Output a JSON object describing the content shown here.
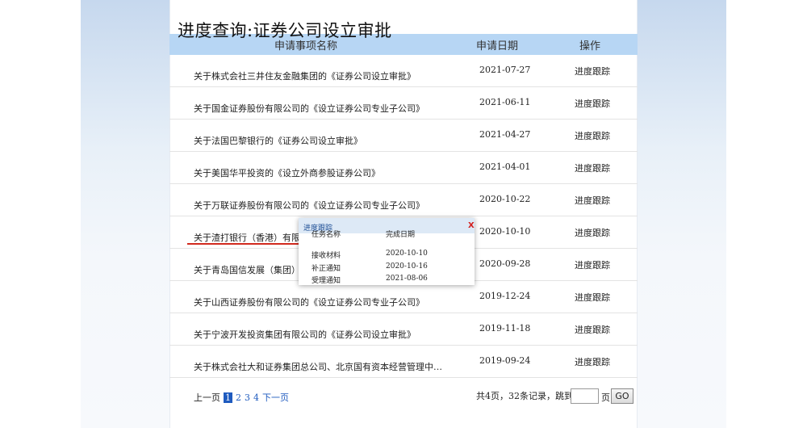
{
  "page_title": "进度查询:证券公司设立审批",
  "table": {
    "headers": {
      "name": "申请事项名称",
      "date": "申请日期",
      "op": "操作"
    },
    "rows": [
      {
        "name": "关于株式会社三井住友金融集团的《证券公司设立审批》",
        "date": "2021-07-27",
        "op": "进度跟踪"
      },
      {
        "name": "关于国金证券股份有限公司的《设立证券公司专业子公司》",
        "date": "2021-06-11",
        "op": "进度跟踪"
      },
      {
        "name": "关于法国巴黎银行的《证券公司设立审批》",
        "date": "2021-04-27",
        "op": "进度跟踪"
      },
      {
        "name": "关于美国华平投资的《设立外商参股证券公司》",
        "date": "2021-04-01",
        "op": "进度跟踪"
      },
      {
        "name": "关于万联证券股份有限公司的《设立证券公司专业子公司》",
        "date": "2020-10-22",
        "op": "进度跟踪"
      },
      {
        "name": "关于渣打银行（香港）有限公",
        "date": "2020-10-10",
        "op": "进度跟踪"
      },
      {
        "name": "关于青岛国信发展（集团）有",
        "date": "2020-09-28",
        "op": "进度跟踪"
      },
      {
        "name": "关于山西证券股份有限公司的《设立证券公司专业子公司》",
        "date": "2019-12-24",
        "op": "进度跟踪"
      },
      {
        "name": "关于宁波开发投资集团有限公司的《证券公司设立审批》",
        "date": "2019-11-18",
        "op": "进度跟踪"
      },
      {
        "name": "关于株式会社大和证券集团总公司、北京国有资本经营管理中…",
        "date": "2019-09-24",
        "op": "进度跟踪"
      }
    ]
  },
  "popup": {
    "title": "进度跟踪",
    "close": "X",
    "col_task": "任务名称",
    "col_date": "完成日期",
    "steps": [
      {
        "task": "接收材料",
        "date": "2020-10-10"
      },
      {
        "task": "补正通知",
        "date": "2020-10-16"
      },
      {
        "task": "受理通知",
        "date": "2021-08-06"
      }
    ]
  },
  "pagination": {
    "prev": "上一页",
    "pages": [
      "1",
      "2",
      "3",
      "4"
    ],
    "current": "1",
    "next": "下一页",
    "summary": "共4页，32条记录，跳到",
    "page_suffix": "页",
    "go": "GO"
  },
  "colors": {
    "header_bg": "#b7d6f4",
    "link": "#1f5bbf",
    "highlight_underline": "#d12a1e",
    "popup_close": "#d4201c"
  }
}
